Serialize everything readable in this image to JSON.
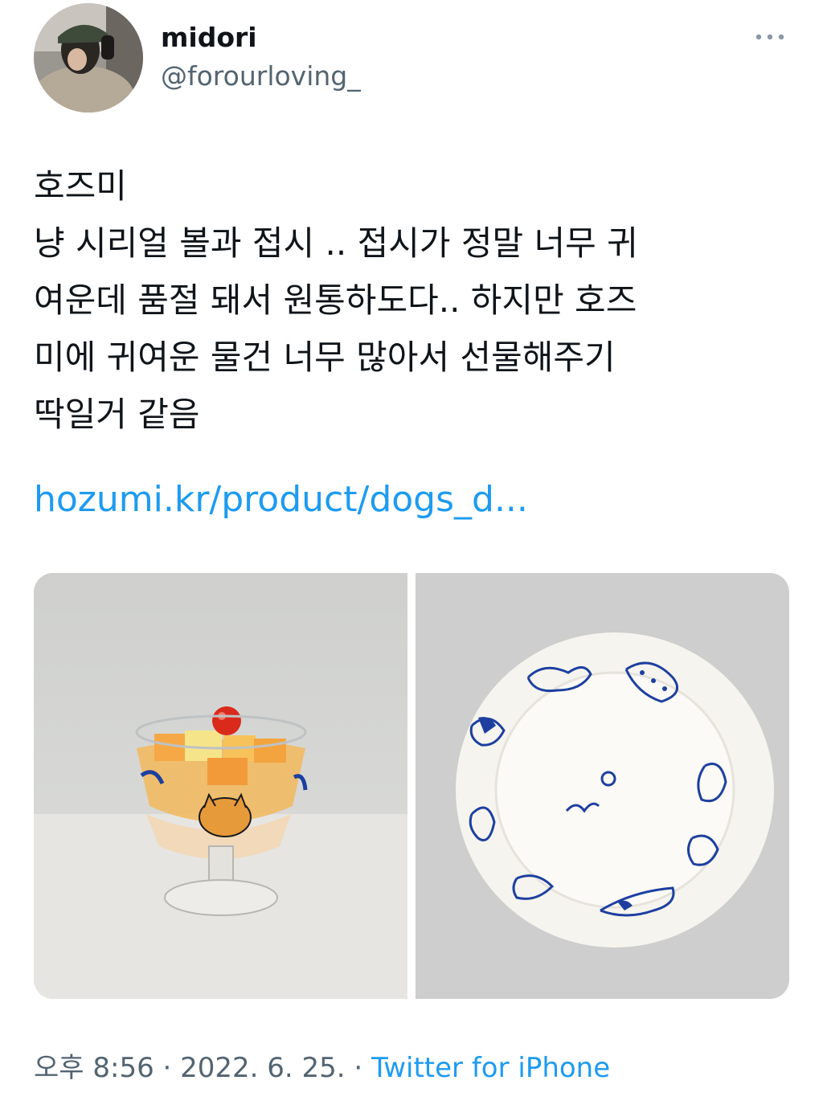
{
  "author": {
    "display_name": "midori",
    "handle": "@forourloving_"
  },
  "more_icon": "more-horizontal-icon",
  "tweet": {
    "lines": [
      "호즈미",
      "냥 시리얼 볼과 접시 .. 접시가 정말 너무 귀",
      "여운데 품절 돼서 원통하도다.. 하지만 호즈",
      "미에 귀여운 물건 너무 많아서 선물해주기",
      "딱일거 같음"
    ],
    "link": "hozumi.kr/product/dogs_d..."
  },
  "meta": {
    "time": "오후 8:56",
    "separator": " · ",
    "date": "2022. 6. 25.",
    "source": "Twitter for iPhone"
  },
  "colors": {
    "link": "#1d9bf0",
    "secondary_text": "#536471",
    "plate_ink": "#1d3fa0"
  }
}
